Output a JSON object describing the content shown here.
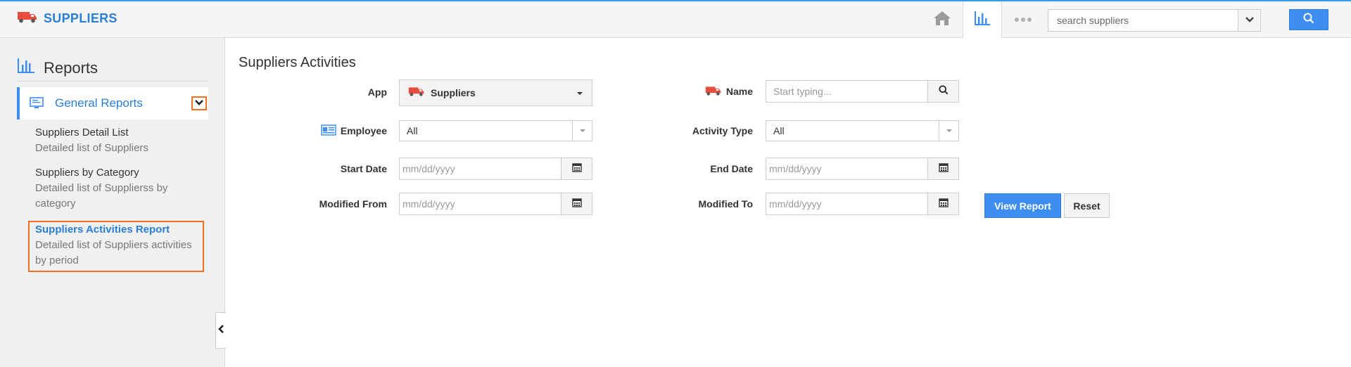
{
  "app": {
    "title": "SUPPLIERS"
  },
  "header": {
    "search_placeholder": "search suppliers"
  },
  "sidebar": {
    "title": "Reports",
    "group_label": "General Reports",
    "items": [
      {
        "title": "Suppliers Detail List",
        "desc": "Detailed list of Suppliers"
      },
      {
        "title": "Suppliers by Category",
        "desc": "Detailed list of Supplierss by category"
      },
      {
        "title": "Suppliers Activities Report",
        "desc": "Detailed list of Suppliers activities by period"
      }
    ]
  },
  "main": {
    "title": "Suppliers Activities",
    "form": {
      "app_label": "App",
      "app_value": "Suppliers",
      "name_label": "Name",
      "name_placeholder": "Start typing...",
      "employee_label": "Employee",
      "employee_value": "All",
      "activity_type_label": "Activity Type",
      "activity_type_value": "All",
      "start_date_label": "Start Date",
      "end_date_label": "End Date",
      "modified_from_label": "Modified From",
      "modified_to_label": "Modified To",
      "date_placeholder": "mm/dd/yyyy",
      "view_report_label": "View Report",
      "reset_label": "Reset"
    }
  },
  "colors": {
    "accent": "#3d8ef0",
    "brand_text": "#2a7fd4",
    "highlight": "#f07020",
    "truck": "#e84c3d"
  },
  "icons": [
    "truck-icon",
    "home-icon",
    "bar-chart-icon",
    "more-icon",
    "chevron-down-icon",
    "search-icon",
    "monitor-icon",
    "chevron-left-icon",
    "id-card-icon",
    "calendar-icon",
    "caret-down-icon"
  ]
}
